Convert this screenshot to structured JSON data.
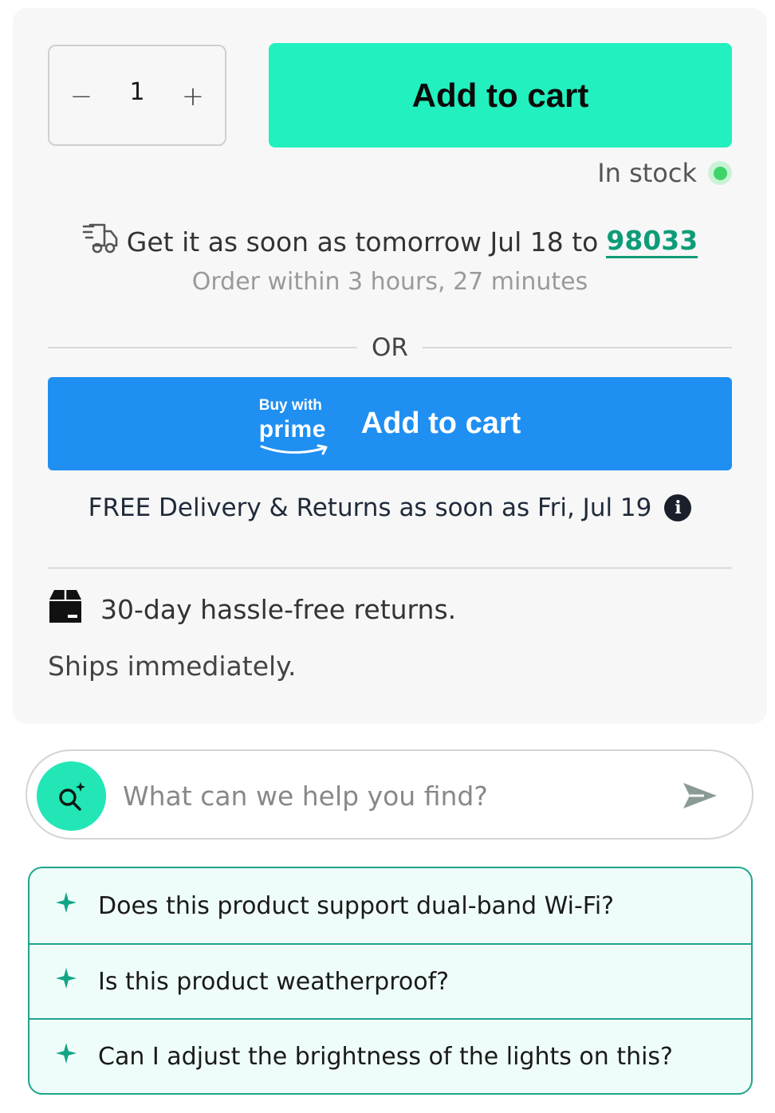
{
  "quantity": {
    "decrement_label": "−",
    "value": "1",
    "increment_label": "+"
  },
  "add_to_cart": {
    "label": "Add to cart"
  },
  "stock": {
    "label": "In stock",
    "status_color": "#3ed46a"
  },
  "delivery": {
    "prefix": "Get it as soon as tomorrow Jul 18 to",
    "zip": "98033",
    "order_within": "Order within 3 hours, 27 minutes"
  },
  "separator": {
    "label": "OR"
  },
  "prime_button": {
    "logo_top": "Buy with",
    "logo_bottom": "prime",
    "label": "Add to cart",
    "color": "#1f8ff2"
  },
  "free_delivery": {
    "text": "FREE Delivery & Returns as soon as Fri, Jul 19",
    "icon": "info-icon"
  },
  "returns": {
    "text": "30-day hassle-free returns.",
    "icon": "box-icon"
  },
  "ships": {
    "text": "Ships immediately."
  },
  "search": {
    "placeholder": "What can we help you find?",
    "icon": "search-sparkle-icon",
    "send_icon": "send-icon",
    "accent": "#22e6b5"
  },
  "suggestions": [
    {
      "text": "Does this product support dual-band Wi-Fi?"
    },
    {
      "text": "Is this product weatherproof?"
    },
    {
      "text": "Can I adjust the brightness of the lights on this?"
    }
  ],
  "theme": {
    "accent_green": "#22f0bf",
    "link_green": "#0e9c78",
    "suggest_border": "#1ea58a"
  }
}
